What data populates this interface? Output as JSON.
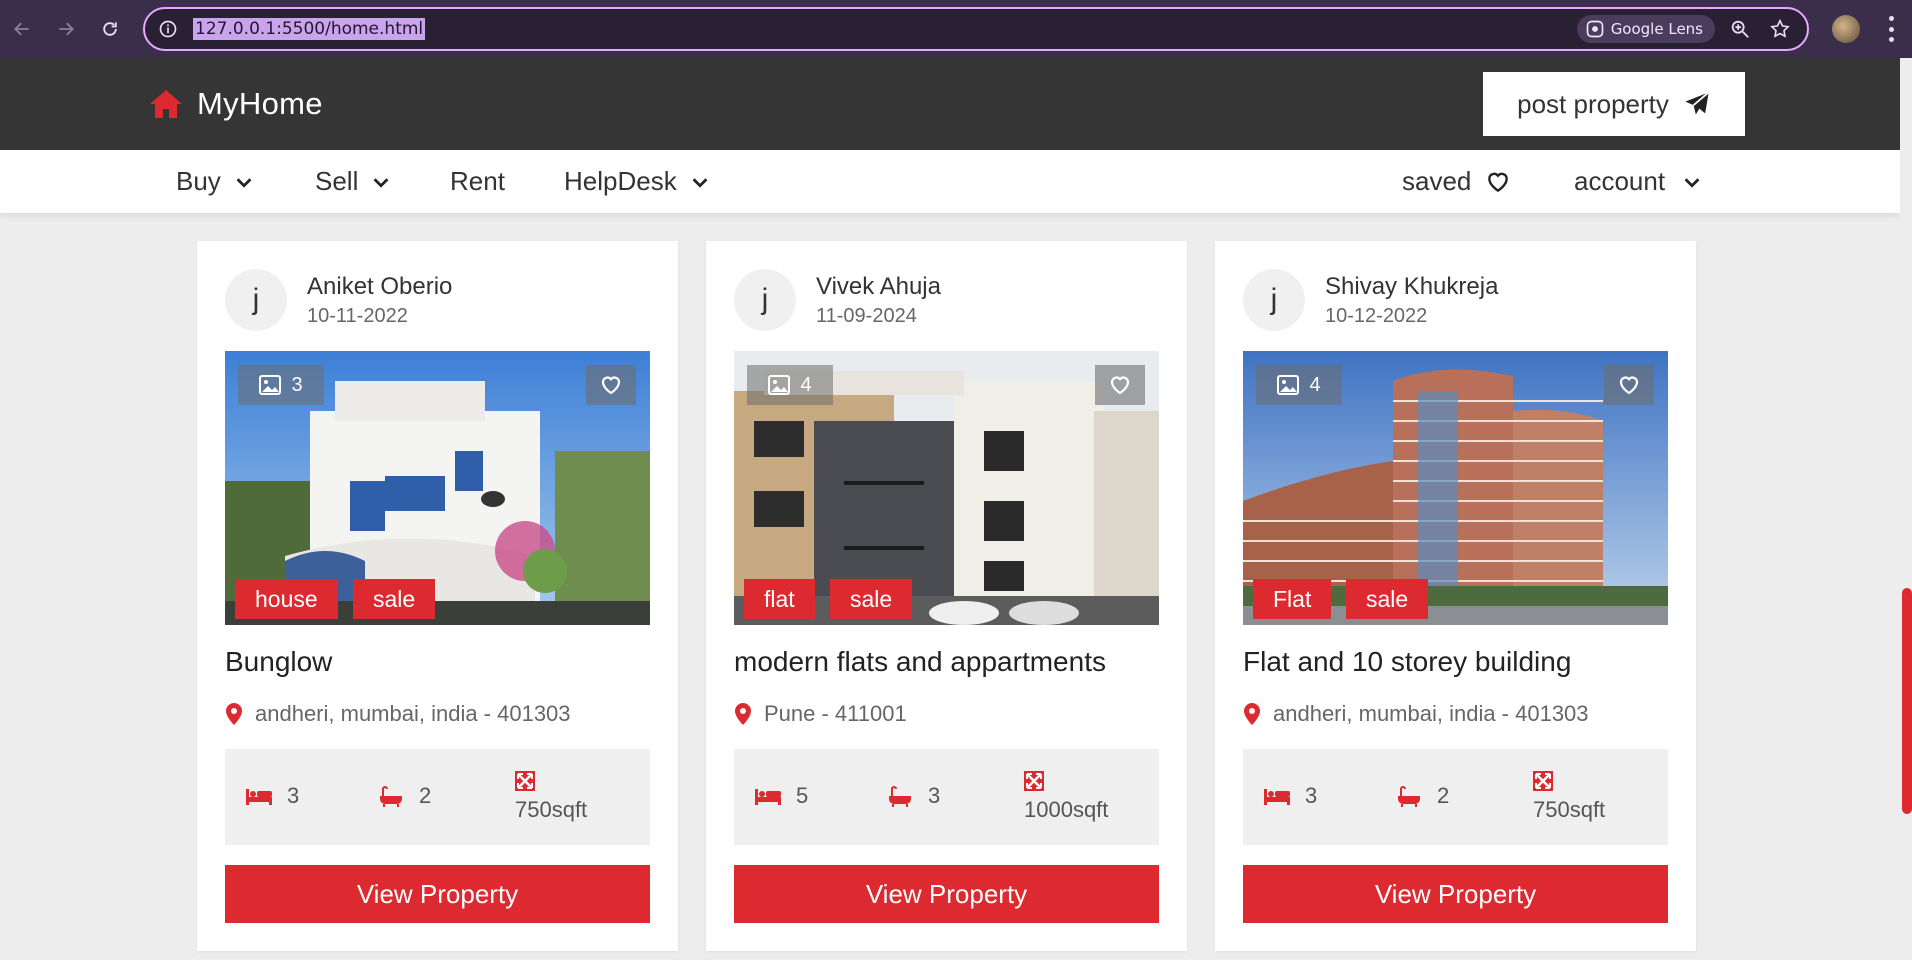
{
  "browser": {
    "url": "127.0.0.1:5500/home.html",
    "lens_label": "Google Lens"
  },
  "site": {
    "brand": "MyHome",
    "post_property_label": "post property",
    "accent_color": "#dc2a30"
  },
  "nav": {
    "left": [
      {
        "label": "Buy",
        "has_dropdown": true
      },
      {
        "label": "Sell",
        "has_dropdown": true
      },
      {
        "label": "Rent",
        "has_dropdown": false
      },
      {
        "label": "HelpDesk",
        "has_dropdown": true
      }
    ],
    "saved_label": "saved",
    "account_label": "account"
  },
  "cards": [
    {
      "avatar_letter": "j",
      "owner": "Aniket Oberio",
      "date": "10-11-2022",
      "image_count": "3",
      "tags": [
        "house",
        "sale"
      ],
      "title": "Bunglow",
      "address": "andheri, mumbai, india - 401303",
      "beds": "3",
      "baths": "2",
      "area": "750sqft",
      "button": "View Property"
    },
    {
      "avatar_letter": "j",
      "owner": "Vivek Ahuja",
      "date": "11-09-2024",
      "image_count": "4",
      "tags": [
        "flat",
        "sale"
      ],
      "title": "modern flats and appartments",
      "address": "Pune - 411001",
      "beds": "5",
      "baths": "3",
      "area": "1000sqft",
      "button": "View Property"
    },
    {
      "avatar_letter": "j",
      "owner": "Shivay Khukreja",
      "date": "10-12-2022",
      "image_count": "4",
      "tags": [
        "Flat",
        "sale"
      ],
      "title": "Flat and 10 storey building",
      "address": "andheri, mumbai, india - 401303",
      "beds": "3",
      "baths": "2",
      "area": "750sqft",
      "button": "View Property"
    }
  ]
}
